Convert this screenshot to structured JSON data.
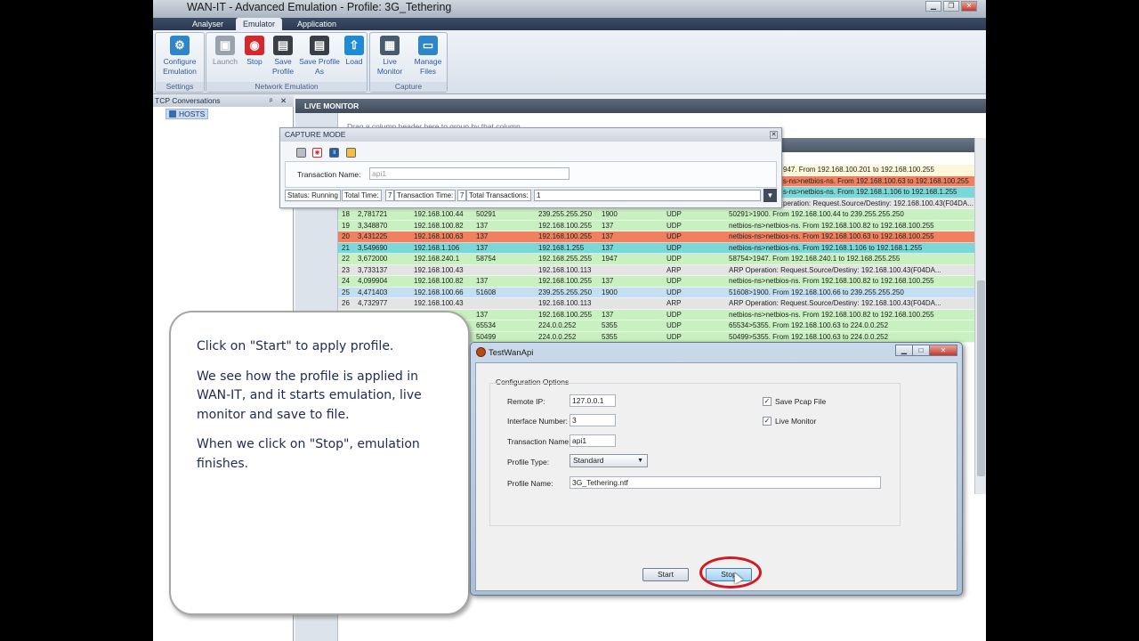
{
  "app": {
    "title": "WAN-IT - Advanced Emulation - Profile: 3G_Tethering",
    "window_controls": [
      "▁",
      "❐",
      "✕"
    ]
  },
  "menu": [
    {
      "label": "Analyser",
      "active": false
    },
    {
      "label": "Emulator",
      "active": true
    },
    {
      "label": "Application",
      "active": false
    }
  ],
  "ribbon": {
    "settings": {
      "group": "Settings",
      "configure": "Configure Emulation"
    },
    "network": {
      "group": "Network Emulation",
      "launch": "Launch",
      "stop": "Stop",
      "save_profile": "Save Profile",
      "save_profile_as": "Save Profile As",
      "load": "Load"
    },
    "capture": {
      "group": "Capture",
      "live_monitor": "Live Monitor",
      "manage_files": "Manage Files"
    }
  },
  "tcp_panel": {
    "title": "TCP Conversations",
    "pin": "ᵖ",
    "close": "✕",
    "hosts": "HOSTS"
  },
  "live_monitor": {
    "title": "LIVE MONITOR",
    "group_hint": "Drag a column header here to group by that column",
    "partial_rows": [
      "947. From 192.168.100.201 to 192.168.100.255",
      "s-ns>netbios-ns. From 192.168.100.63 to 192.168.100.255",
      "s-ns>netbios-ns. From 192.168.1.106 to 192.168.1.255",
      "peration: Request.Source/Destiny: 192.168.100.43(F04DA..."
    ],
    "rows": [
      {
        "no": "18",
        "time": "2,781721",
        "src": "192.168.100.44",
        "sport": "50291",
        "dst": "239.255.255.250",
        "dport": "1900",
        "proto": "UDP",
        "info": "50291>1900. From 192.168.100.44 to 239.255.255.250",
        "color": "#c8f0c0"
      },
      {
        "no": "19",
        "time": "3,348870",
        "src": "192.168.100.82",
        "sport": "137",
        "dst": "192.168.100.255",
        "dport": "137",
        "proto": "UDP",
        "info": "netbios-ns>netbios-ns. From 192.168.100.82 to 192.168.100.255",
        "color": "#c8f0c0"
      },
      {
        "no": "20",
        "time": "3,431225",
        "src": "192.168.100.63",
        "sport": "137",
        "dst": "192.168.100.255",
        "dport": "137",
        "proto": "UDP",
        "info": "netbios-ns>netbios-ns. From 192.168.100.63 to 192.168.100.255",
        "color": "#f08060"
      },
      {
        "no": "21",
        "time": "3,549690",
        "src": "192.168.1.106",
        "sport": "137",
        "dst": "192.168.1.255",
        "dport": "137",
        "proto": "UDP",
        "info": "netbios-ns>netbios-ns. From 192.168.1.106 to 192.168.1.255",
        "color": "#7ad8d8"
      },
      {
        "no": "22",
        "time": "3,672000",
        "src": "192.168.240.1",
        "sport": "58754",
        "dst": "192.168.255.255",
        "dport": "1947",
        "proto": "UDP",
        "info": "58754>1947. From 192.168.240.1 to 192.168.255.255",
        "color": "#c8f0c0"
      },
      {
        "no": "23",
        "time": "3,733137",
        "src": "192.168.100.43",
        "sport": "",
        "dst": "192.168.100.113",
        "dport": "",
        "proto": "ARP",
        "info": "ARP Operation: Request.Source/Destiny: 192.168.100.43(F04DA...",
        "color": "#e4e4e4"
      },
      {
        "no": "24",
        "time": "4,099904",
        "src": "192.168.100.82",
        "sport": "137",
        "dst": "192.168.100.255",
        "dport": "137",
        "proto": "UDP",
        "info": "netbios-ns>netbios-ns. From 192.168.100.82 to 192.168.100.255",
        "color": "#c8f0c0"
      },
      {
        "no": "25",
        "time": "4,471403",
        "src": "192.168.100.66",
        "sport": "51608",
        "dst": "239.255.255.250",
        "dport": "1900",
        "proto": "UDP",
        "info": "51608>1900. From 192.168.100.66 to 239.255.255.250",
        "color": "#c4dff2"
      },
      {
        "no": "26",
        "time": "4,732977",
        "src": "192.168.100.43",
        "sport": "",
        "dst": "192.168.100.113",
        "dport": "",
        "proto": "ARP",
        "info": "ARP Operation: Request.Source/Destiny: 192.168.100.43(F04DA...",
        "color": "#e4e4e4"
      },
      {
        "no": "",
        "time": "",
        "src": "168.100.82",
        "sport": "137",
        "dst": "192.168.100.255",
        "dport": "137",
        "proto": "UDP",
        "info": "netbios-ns>netbios-ns. From 192.168.100.82 to 192.168.100.255",
        "color": "#c8f0c0"
      },
      {
        "no": "",
        "time": "",
        "src": "100.63",
        "sport": "65534",
        "dst": "224.0.0.252",
        "dport": "5355",
        "proto": "UDP",
        "info": "65534>5355. From 192.168.100.63 to 224.0.0.252",
        "color": "#c8f0c0"
      },
      {
        "no": "",
        "time": "",
        "src": "100.63",
        "sport": "50499",
        "dst": "224.0.0.252",
        "dport": "5355",
        "proto": "UDP",
        "info": "50499>5355. From 192.168.100.63 to 224.0.0.252",
        "color": "#c8f0c0"
      }
    ]
  },
  "capture_mode": {
    "title": "CAPTURE MODE",
    "close": "✕",
    "transaction_label": "Transaction Name:",
    "transaction_value": "api1",
    "status": "Status: Running",
    "total_time_label": "Total Time:",
    "total_time_value": "7",
    "transaction_time_label": "Transaction Time:",
    "transaction_time_value": "7",
    "total_transactions_label": "Total Transactions:",
    "total_transactions_value": "1",
    "dropdown": "▼"
  },
  "callout": {
    "p1": "Click on \"Start\" to apply profile.",
    "p2": "We see how the profile is applied in WAN-IT, and it starts emulation, live monitor and save to file.",
    "p3": "When we click on \"Stop\", emulation finishes."
  },
  "testwanapi": {
    "title": "TestWanApi",
    "controls": [
      "▁",
      "□",
      "✕"
    ],
    "group": "Configuration Options",
    "remote_ip_label": "Remote IP:",
    "remote_ip": "127.0.0.1",
    "interface_label": "Interface Number:",
    "interface": "3",
    "transaction_label": "Transaction Name:",
    "transaction": "api1",
    "profile_type_label": "Profile Type:",
    "profile_type": "Standard",
    "profile_name_label": "Profile Name:",
    "profile_name": "3G_Tethering.ntf",
    "save_pcap": "Save Pcap File",
    "live_monitor": "Live Monitor",
    "check": "✓",
    "start": "Start",
    "stop": "Stop"
  }
}
